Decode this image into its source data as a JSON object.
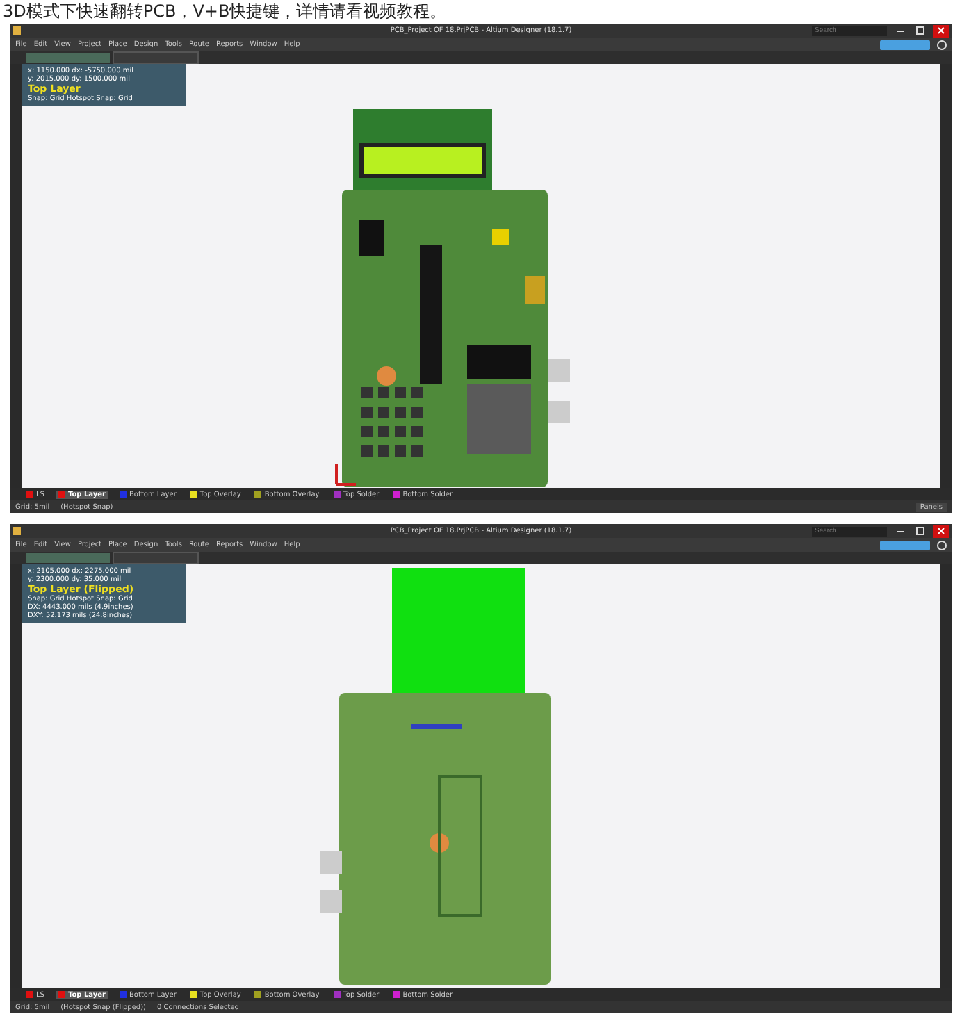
{
  "caption": "3D模式下快速翻转PCB，V+B快捷键，详情请看视频教程。",
  "screenshots": [
    {
      "kind": "front",
      "title": "PCB_Project OF 18.PrjPCB - Altium Designer (18.1.7)",
      "search": {
        "placeholder": "Search"
      },
      "menu": [
        "File",
        "Edit",
        "View",
        "Project",
        "Place",
        "Design",
        "Tools",
        "Route",
        "Reports",
        "Window",
        "Help"
      ],
      "info": {
        "lines": [
          "x: 1150.000   dx: -5750.000 mil",
          "y: 2015.000   dy: 1500.000 mil"
        ],
        "layer": "Top Layer",
        "details": [
          "Snap: Grid Hotspot Snap: Grid"
        ]
      },
      "layers": [
        {
          "label": "LS",
          "color": "#e01010",
          "selected": false
        },
        {
          "label": "Top Layer",
          "color": "#e01010",
          "selected": true
        },
        {
          "label": "Bottom Layer",
          "color": "#2030e0",
          "selected": false
        },
        {
          "label": "Top Overlay",
          "color": "#e8e020",
          "selected": false
        },
        {
          "label": "Bottom Overlay",
          "color": "#a0a020",
          "selected": false
        },
        {
          "label": "Top Solder",
          "color": "#a030c0",
          "selected": false
        },
        {
          "label": "Bottom Solder",
          "color": "#d020d0",
          "selected": false
        }
      ],
      "status": [
        "Grid: 5mil",
        "(Hotspot Snap)"
      ],
      "panels": "Panels"
    },
    {
      "kind": "back",
      "title": "PCB_Project OF 18.PrjPCB - Altium Designer (18.1.7)",
      "search": {
        "placeholder": "Search"
      },
      "menu": [
        "File",
        "Edit",
        "View",
        "Project",
        "Place",
        "Design",
        "Tools",
        "Route",
        "Reports",
        "Window",
        "Help"
      ],
      "info": {
        "lines": [
          "x: 2105.000   dx: 2275.000 mil",
          "y: 2300.000   dy: 35.000 mil"
        ],
        "layer": "Top Layer (Flipped)",
        "details": [
          "Snap: Grid Hotspot Snap: Grid",
          "DX: 4443.000 mils (4.9inches)",
          "DXY: 52.173 mils (24.8inches)"
        ]
      },
      "layers": [
        {
          "label": "LS",
          "color": "#e01010",
          "selected": false
        },
        {
          "label": "Top Layer",
          "color": "#e01010",
          "selected": true
        },
        {
          "label": "Bottom Layer",
          "color": "#2030e0",
          "selected": false
        },
        {
          "label": "Top Overlay",
          "color": "#e8e020",
          "selected": false
        },
        {
          "label": "Bottom Overlay",
          "color": "#a0a020",
          "selected": false
        },
        {
          "label": "Top Solder",
          "color": "#a030c0",
          "selected": false
        },
        {
          "label": "Bottom Solder",
          "color": "#d020d0",
          "selected": false
        }
      ],
      "status": [
        "Grid: 5mil",
        "(Hotspot Snap (Flipped))",
        "0 Connections Selected"
      ]
    }
  ]
}
